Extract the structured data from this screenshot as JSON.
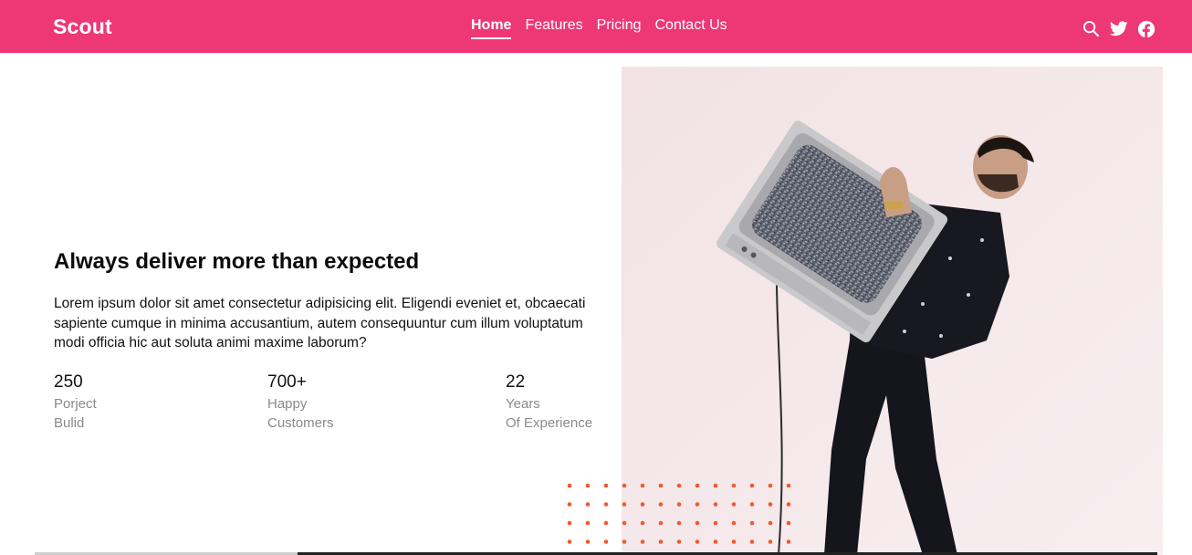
{
  "navbar": {
    "brand": "Scout",
    "links": [
      {
        "label": "Home",
        "active": true
      },
      {
        "label": "Features",
        "active": false
      },
      {
        "label": "Pricing",
        "active": false
      },
      {
        "label": "Contact Us",
        "active": false
      }
    ],
    "icons": [
      "search-icon",
      "twitter-icon",
      "facebook-icon"
    ],
    "background_color": "#ee3775"
  },
  "hero": {
    "title": "Always deliver more than expected",
    "text": "Lorem ipsum dolor sit amet consectetur adipisicing elit. Eligendi eveniet et, obcaecati sapiente cumque in minima accusantium, autem consequuntur cum illum voluptatum modi officia hic aut soluta animi maxime laborum?",
    "stats": [
      {
        "number": "250",
        "label_line1": "Porject",
        "label_line2": "Bulid"
      },
      {
        "number": "700+",
        "label_line1": "Happy",
        "label_line2": "Customers"
      },
      {
        "number": "22",
        "label_line1": "Years",
        "label_line2": "Of Experience"
      }
    ]
  },
  "decor": {
    "dots_color": "#f05a2b",
    "photo_background": "#f3e4e7"
  }
}
